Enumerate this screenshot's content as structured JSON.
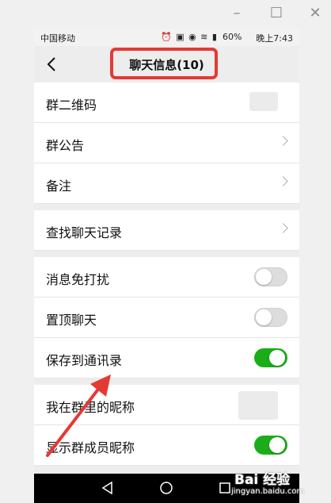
{
  "status_bar": {
    "carrier": "中国移动",
    "battery": "60%",
    "time": "晚上7:43"
  },
  "nav": {
    "title": "聊天信息(10)"
  },
  "rows": {
    "qr_code": "群二维码",
    "announcement": "群公告",
    "remark": "备注",
    "search_history": "查找聊天记录",
    "mute": "消息免打扰",
    "sticky": "置顶聊天",
    "save_contacts": "保存到通讯录",
    "my_nickname": "我在群里的昵称",
    "show_nicknames": "显示群成员昵称"
  },
  "toggles": {
    "mute": false,
    "sticky": false,
    "save_contacts": true,
    "show_nicknames": true
  },
  "watermark": {
    "main": "Bai 经验",
    "sub": "jingyan.baidu.com"
  },
  "colors": {
    "toggle_on": "#1aad19",
    "highlight": "#e53935"
  }
}
